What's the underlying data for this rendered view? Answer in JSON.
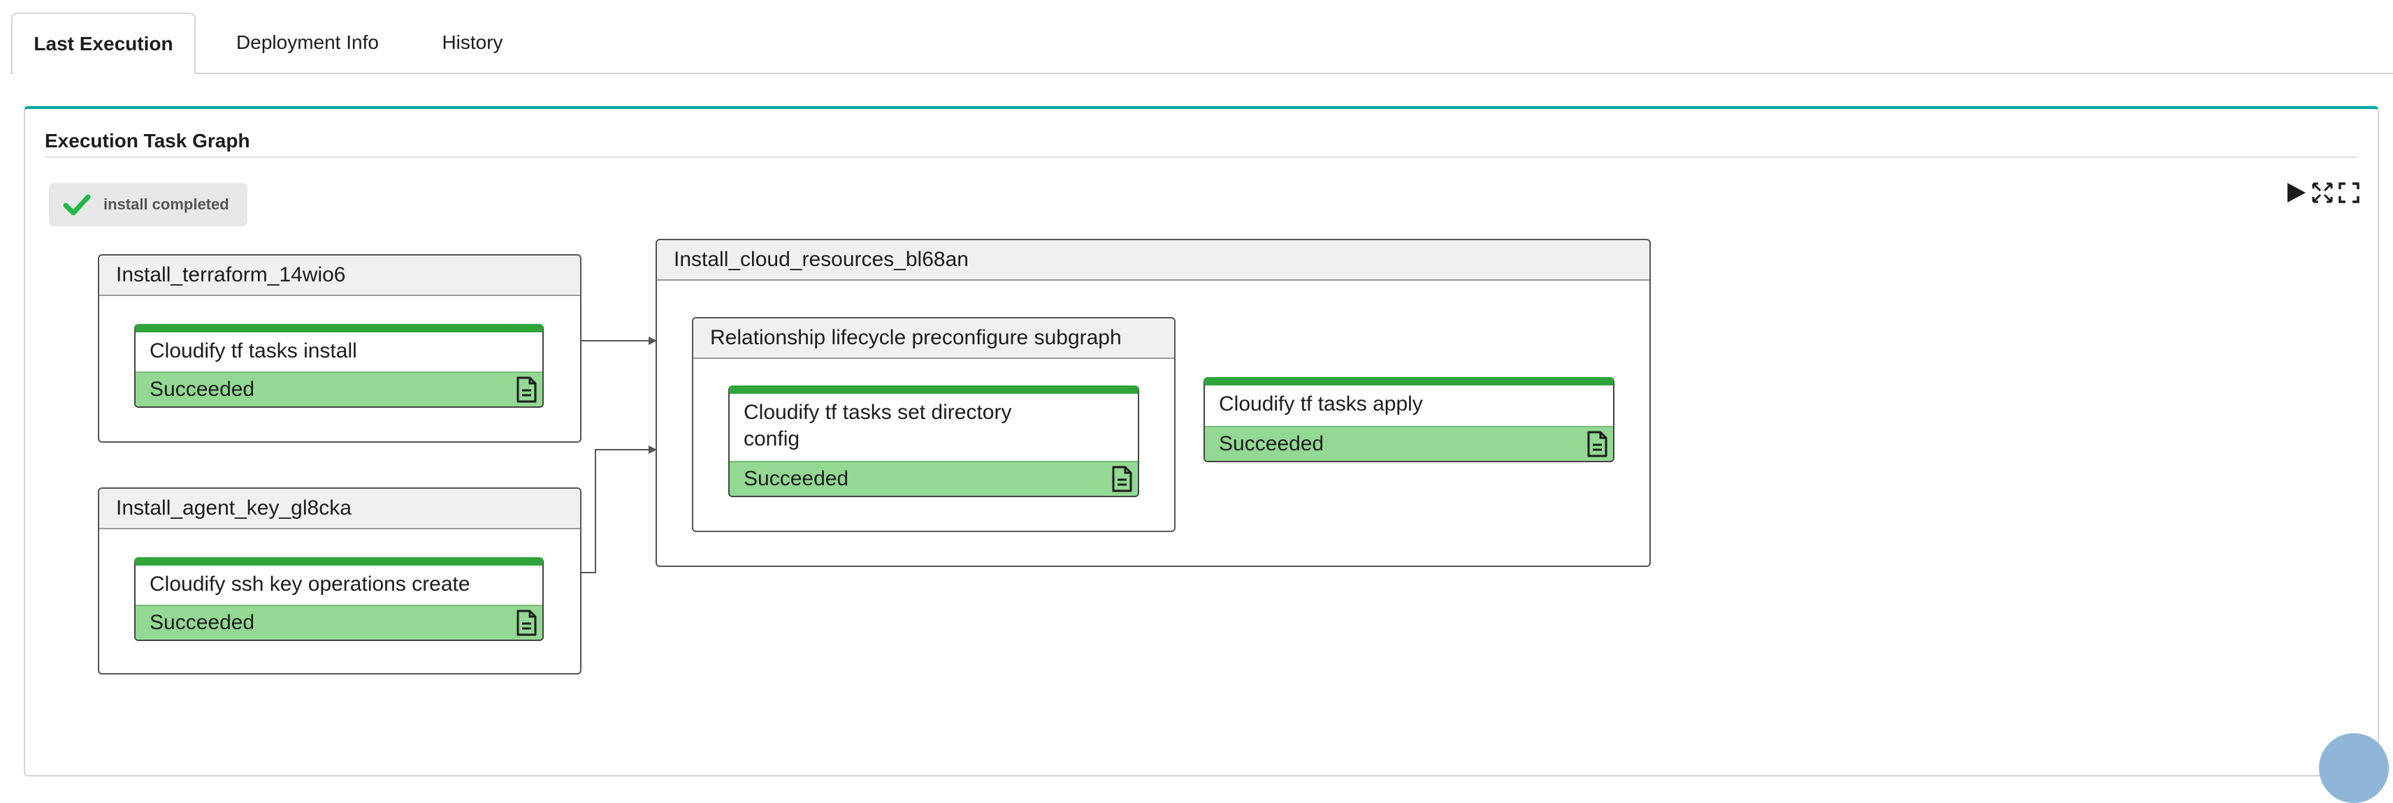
{
  "tabs": [
    {
      "label": "Last Execution"
    },
    {
      "label": "Deployment Info"
    },
    {
      "label": "History"
    }
  ],
  "panel": {
    "title": "Execution Task Graph",
    "status": "install completed"
  },
  "graph": {
    "groups": [
      {
        "name": "Install_terraform_14wio6",
        "tasks": [
          {
            "name": "Cloudify tf tasks install",
            "status": "Succeeded"
          }
        ]
      },
      {
        "name": "Install_agent_key_gl8cka",
        "tasks": [
          {
            "name": "Cloudify ssh key operations create",
            "status": "Succeeded"
          }
        ]
      },
      {
        "name": "Install_cloud_resources_bl68an",
        "subgraph": {
          "name": "Relationship lifecycle preconfigure subgraph",
          "tasks": [
            {
              "name": "Cloudify tf tasks set directory config",
              "status": "Succeeded"
            }
          ]
        },
        "tasks": [
          {
            "name": "Cloudify tf tasks apply",
            "status": "Succeeded"
          }
        ]
      }
    ]
  },
  "colors": {
    "accent": "#00a7a1",
    "task_bar": "#2fa43a",
    "succeeded": "#93d993",
    "check": "#21ba45"
  },
  "icons": [
    "check-icon",
    "play-icon",
    "fit-to-view-icon",
    "fullscreen-icon",
    "document-icon"
  ]
}
